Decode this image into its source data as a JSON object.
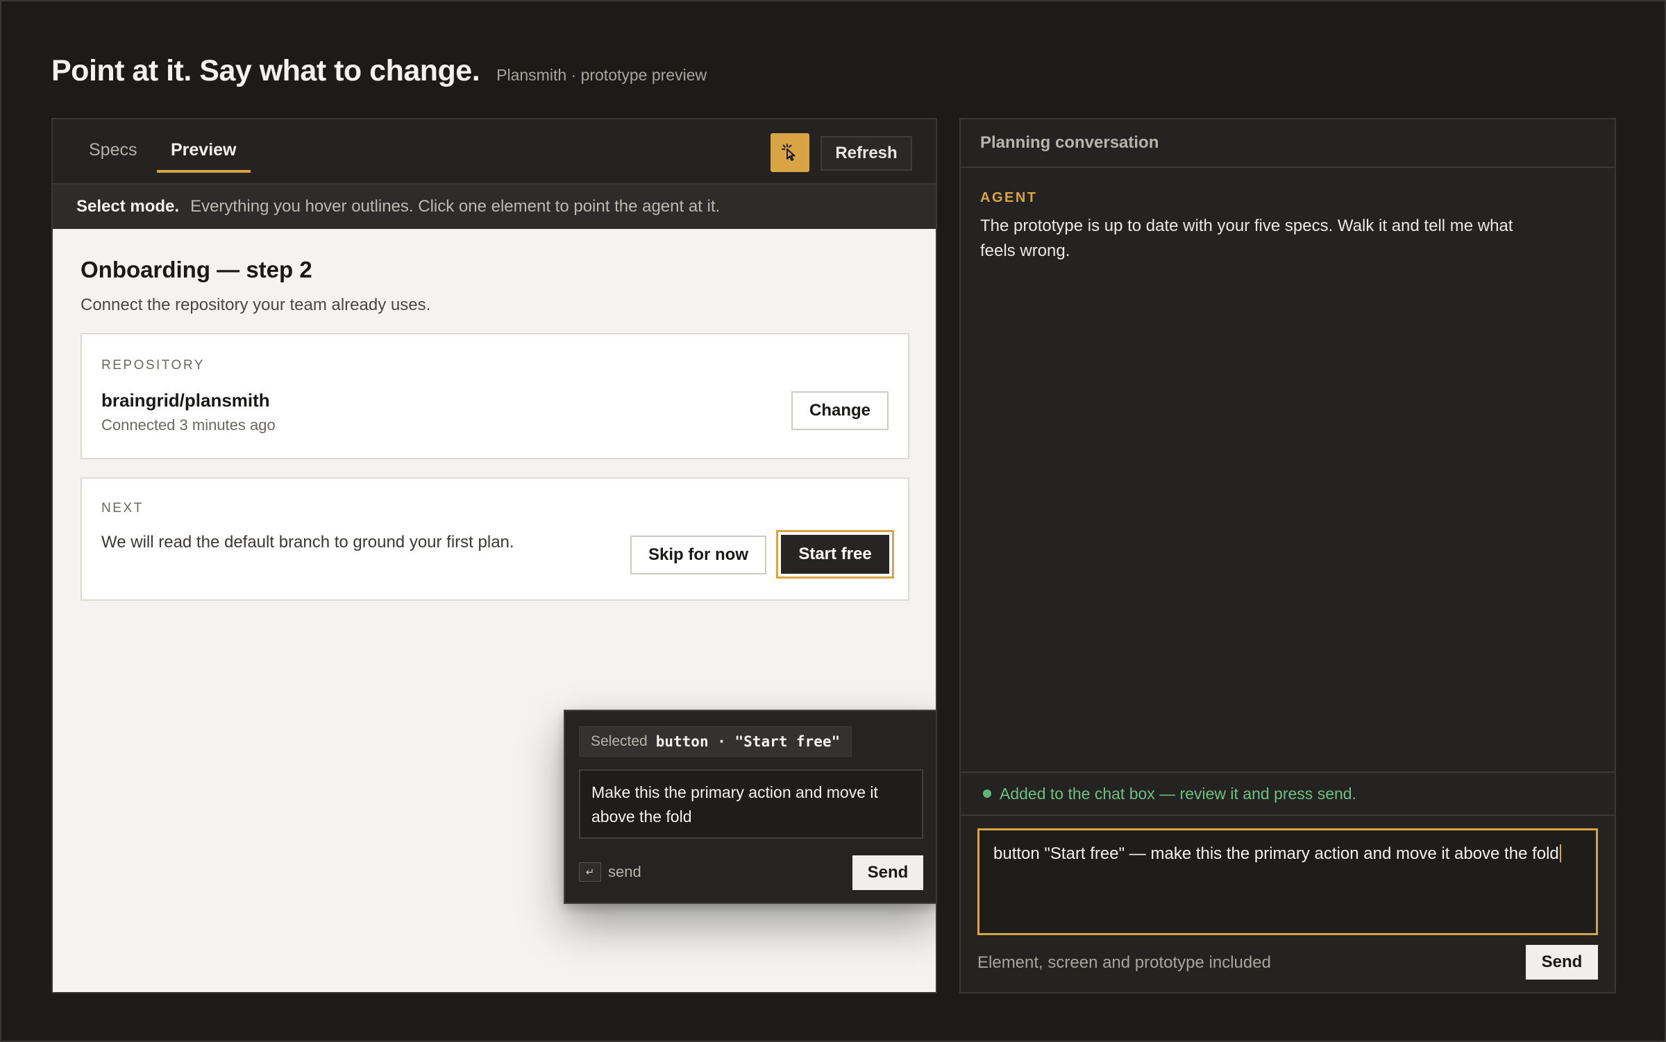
{
  "header": {
    "title": "Point at it. Say what to change.",
    "subtitle": "Plansmith · prototype preview"
  },
  "tabs": [
    {
      "label": "Specs",
      "active": false
    },
    {
      "label": "Preview",
      "active": true
    }
  ],
  "toolbar": {
    "select_icon": "pointer-select-icon",
    "refresh_label": "Refresh",
    "accent_color": "#d9a544"
  },
  "mode_bar": {
    "strong": "Select mode.",
    "text": "Everything you hover outlines. Click one element to point the agent at it."
  },
  "preview": {
    "title": "Onboarding — step 2",
    "subtitle": "Connect the repository your team already uses.",
    "repo_card": {
      "label": "REPOSITORY",
      "name": "braingrid/plansmith",
      "status": "Connected 3 minutes ago",
      "change_label": "Change"
    },
    "next_card": {
      "label": "NEXT",
      "text": "We will read the default branch to ground your first plan.",
      "skip_label": "Skip for now",
      "start_label": "Start free"
    }
  },
  "popover": {
    "chip_label": "Selected",
    "chip_code": "button · \"Start free\"",
    "input_value": "Make this the primary action and move it above the fold",
    "kbd": "↵",
    "hint": "send",
    "send_label": "Send"
  },
  "chat": {
    "header": "Planning conversation",
    "agent_label": "AGENT",
    "agent_message": "The prototype is up to date with your five specs. Walk it and tell me what feels wrong.",
    "status": "Added to the chat box — review it and press send.",
    "status_color": "#6fbf7f",
    "input_value": "button \"Start free\" — make this the primary action and move it above the fold",
    "footer": "Element, screen and prototype included",
    "send_label": "Send"
  }
}
